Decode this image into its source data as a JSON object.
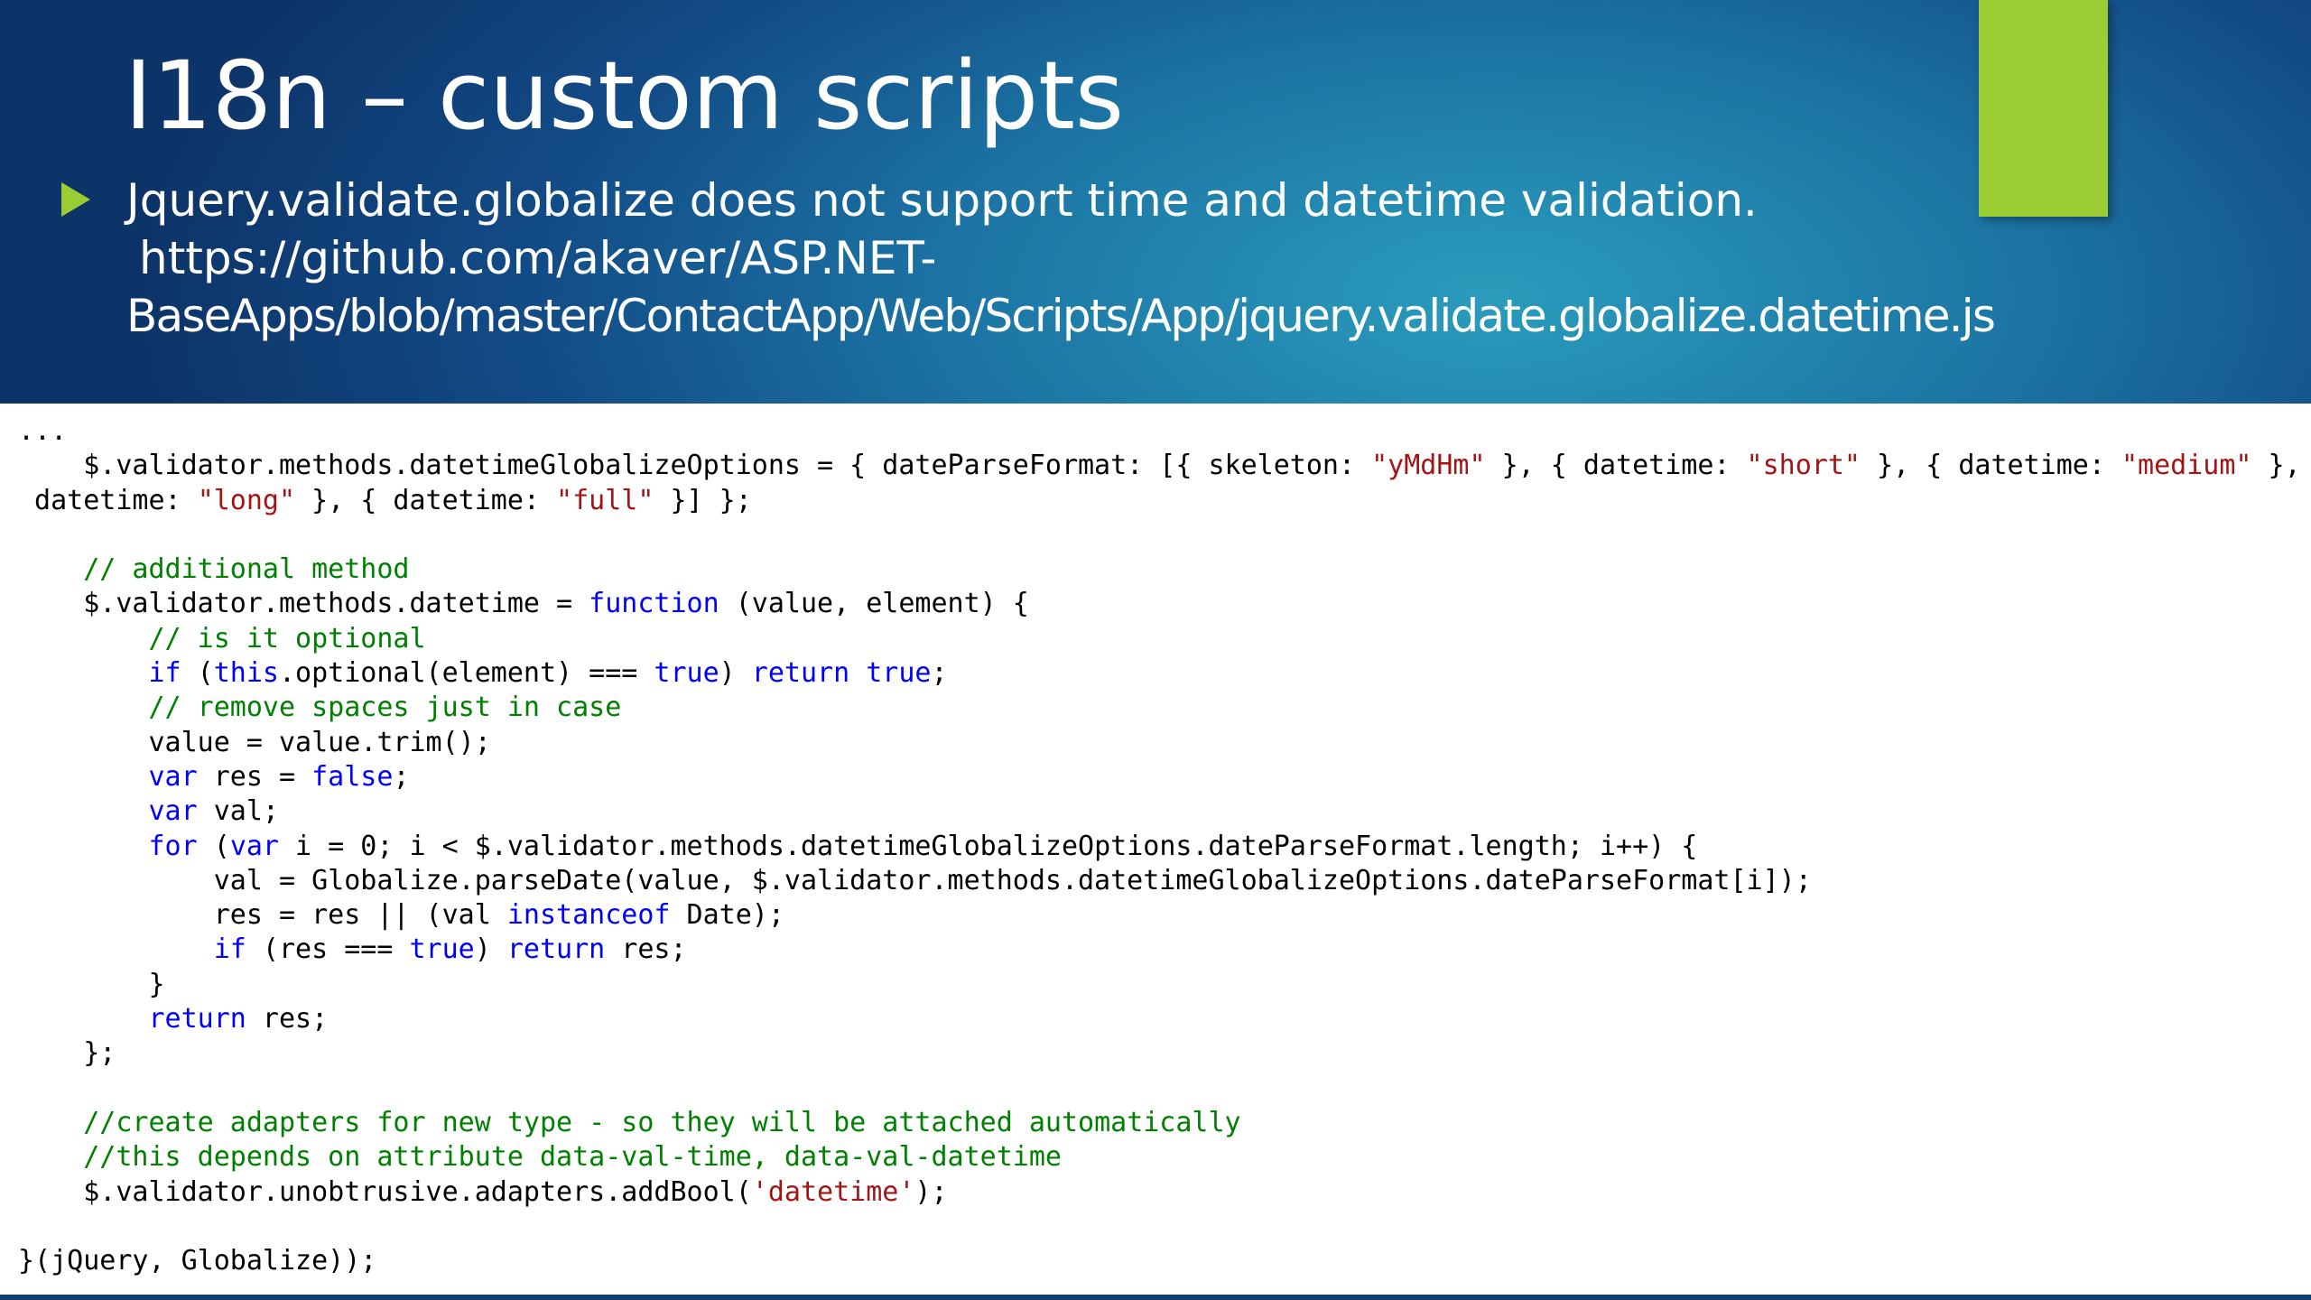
{
  "slide": {
    "title": "I18n – custom scripts",
    "bullet": {
      "line1": "Jquery.validate.globalize does not support time and datetime validation.",
      "line2": "https://github.com/akaver/ASP.NET-",
      "line3": "BaseApps/blob/master/ContactApp/Web/Scripts/App/jquery.validate.globalize.datetime.js"
    },
    "icons": [
      "bullet-arrow-icon"
    ],
    "colors": {
      "header_dark": "#0d3468",
      "header_light": "#2a9cbc",
      "accent_green": "#9acd32",
      "code_keyword": "#0000ff",
      "code_string": "#a31515",
      "code_comment": "#008000"
    }
  },
  "code": {
    "lines": [
      [
        {
          "t": "..."
        }
      ],
      [
        {
          "t": "    $.validator.methods.datetimeGlobalizeOptions = { dateParseFormat: [{ skeleton: "
        },
        {
          "t": "\"yMdHm\"",
          "c": "str"
        },
        {
          "t": " }, { datetime: "
        },
        {
          "t": "\"short\"",
          "c": "str"
        },
        {
          "t": " }, { datetime: "
        },
        {
          "t": "\"medium\"",
          "c": "str"
        },
        {
          "t": " }, {"
        }
      ],
      [
        {
          "t": " datetime: "
        },
        {
          "t": "\"long\"",
          "c": "str"
        },
        {
          "t": " }, { datetime: "
        },
        {
          "t": "\"full\"",
          "c": "str"
        },
        {
          "t": " }] };"
        }
      ],
      [
        {
          "t": ""
        }
      ],
      [
        {
          "t": "    "
        },
        {
          "t": "// additional method",
          "c": "cm"
        }
      ],
      [
        {
          "t": "    $.validator.methods.datetime = "
        },
        {
          "t": "function",
          "c": "kw"
        },
        {
          "t": " (value, element) {"
        }
      ],
      [
        {
          "t": "        "
        },
        {
          "t": "// is it optional",
          "c": "cm"
        }
      ],
      [
        {
          "t": "        "
        },
        {
          "t": "if",
          "c": "kw"
        },
        {
          "t": " ("
        },
        {
          "t": "this",
          "c": "kw"
        },
        {
          "t": ".optional(element) === "
        },
        {
          "t": "true",
          "c": "kw"
        },
        {
          "t": ") "
        },
        {
          "t": "return",
          "c": "kw"
        },
        {
          "t": " "
        },
        {
          "t": "true",
          "c": "kw"
        },
        {
          "t": ";"
        }
      ],
      [
        {
          "t": "        "
        },
        {
          "t": "// remove spaces just in case",
          "c": "cm"
        }
      ],
      [
        {
          "t": "        value = value.trim();"
        }
      ],
      [
        {
          "t": "        "
        },
        {
          "t": "var",
          "c": "kw"
        },
        {
          "t": " res = "
        },
        {
          "t": "false",
          "c": "kw"
        },
        {
          "t": ";"
        }
      ],
      [
        {
          "t": "        "
        },
        {
          "t": "var",
          "c": "kw"
        },
        {
          "t": " val;"
        }
      ],
      [
        {
          "t": "        "
        },
        {
          "t": "for",
          "c": "kw"
        },
        {
          "t": " ("
        },
        {
          "t": "var",
          "c": "kw"
        },
        {
          "t": " i = 0; i < $.validator.methods.datetimeGlobalizeOptions.dateParseFormat.length; i++) {"
        }
      ],
      [
        {
          "t": "            val = Globalize.parseDate(value, $.validator.methods.datetimeGlobalizeOptions.dateParseFormat[i]);"
        }
      ],
      [
        {
          "t": "            res = res || (val "
        },
        {
          "t": "instanceof",
          "c": "kw"
        },
        {
          "t": " Date);"
        }
      ],
      [
        {
          "t": "            "
        },
        {
          "t": "if",
          "c": "kw"
        },
        {
          "t": " (res === "
        },
        {
          "t": "true",
          "c": "kw"
        },
        {
          "t": ") "
        },
        {
          "t": "return",
          "c": "kw"
        },
        {
          "t": " res;"
        }
      ],
      [
        {
          "t": "        }"
        }
      ],
      [
        {
          "t": "        "
        },
        {
          "t": "return",
          "c": "kw"
        },
        {
          "t": " res;"
        }
      ],
      [
        {
          "t": "    };"
        }
      ],
      [
        {
          "t": ""
        }
      ],
      [
        {
          "t": "    "
        },
        {
          "t": "//create adapters for new type - so they will be attached automatically",
          "c": "cm"
        }
      ],
      [
        {
          "t": "    "
        },
        {
          "t": "//this depends on attribute data-val-time, data-val-datetime",
          "c": "cm"
        }
      ],
      [
        {
          "t": "    $.validator.unobtrusive.adapters.addBool("
        },
        {
          "t": "'datetime'",
          "c": "str"
        },
        {
          "t": ");"
        }
      ],
      [
        {
          "t": ""
        }
      ],
      [
        {
          "t": "}(jQuery, Globalize));"
        }
      ]
    ]
  }
}
